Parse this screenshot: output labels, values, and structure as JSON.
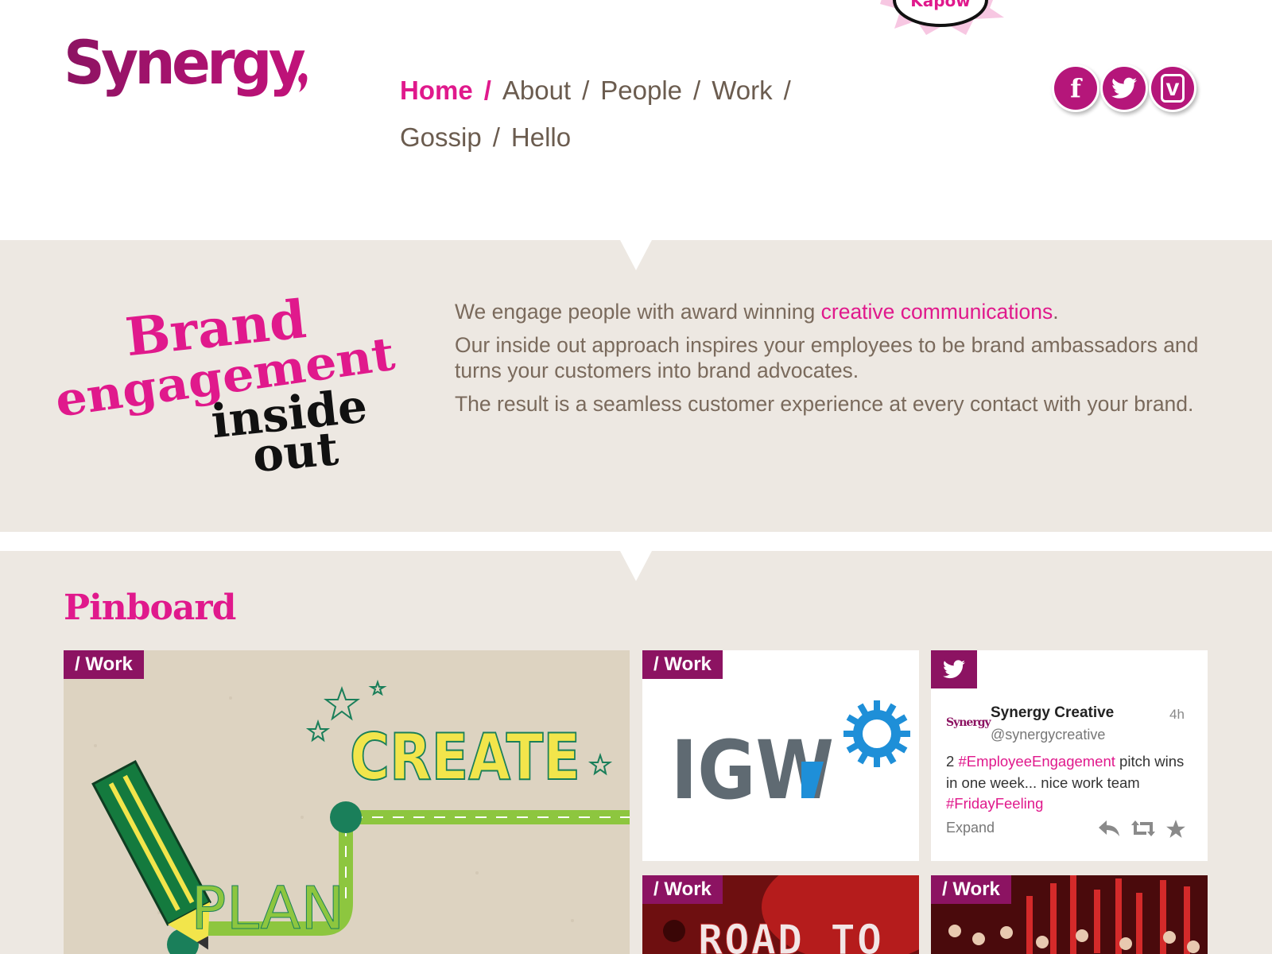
{
  "brand": {
    "logo_text": "Synergy",
    "badge_text": "Kapow"
  },
  "nav": {
    "items": [
      {
        "label": "Home",
        "active": true
      },
      {
        "label": "About",
        "active": false
      },
      {
        "label": "People",
        "active": false
      },
      {
        "label": "Work",
        "active": false
      },
      {
        "label": "Gossip",
        "active": false
      },
      {
        "label": "Hello",
        "active": false
      }
    ],
    "separator": "/"
  },
  "social": [
    {
      "name": "facebook",
      "icon": "facebook-icon",
      "glyph": "f"
    },
    {
      "name": "twitter",
      "icon": "twitter-icon"
    },
    {
      "name": "vimeo",
      "icon": "vimeo-icon",
      "glyph": "v"
    }
  ],
  "intro": {
    "tagline": {
      "line1": "Brand",
      "line2": "engagement",
      "line3": "inside",
      "line4": "out"
    },
    "p1_before": "We engage people with award winning ",
    "p1_link": "creative communications",
    "p1_after": ".",
    "p2": "Our inside out approach inspires your employees to be brand ambassadors and turns your customers into brand advocates.",
    "p3": "The result is a seamless customer experience at every contact with your brand."
  },
  "pinboard": {
    "title": "Pinboard",
    "cards": [
      {
        "tag": "/ Work",
        "image_words": [
          "CREATE",
          "PLAN"
        ]
      },
      {
        "tag": "/ Work",
        "logo_text": "IGW"
      },
      {
        "tag": "/ Work",
        "image_words": [
          "ROAD TO"
        ]
      },
      {
        "tag": "/ Work"
      }
    ],
    "tweet": {
      "logo": "Synergy",
      "name": "Synergy Creative",
      "handle": "@synergycreative",
      "time": "4h",
      "text_1": "2 ",
      "hashtag_1": "#EmployeeEngagement",
      "text_2": " pitch wins in one week... nice work team ",
      "hashtag_2": "#FridayFeeling",
      "expand": "Expand"
    }
  },
  "colors": {
    "accent": "#e0198c",
    "plum": "#8c1362",
    "nav_text": "#6b5c4f",
    "band": "#ede8e2"
  }
}
